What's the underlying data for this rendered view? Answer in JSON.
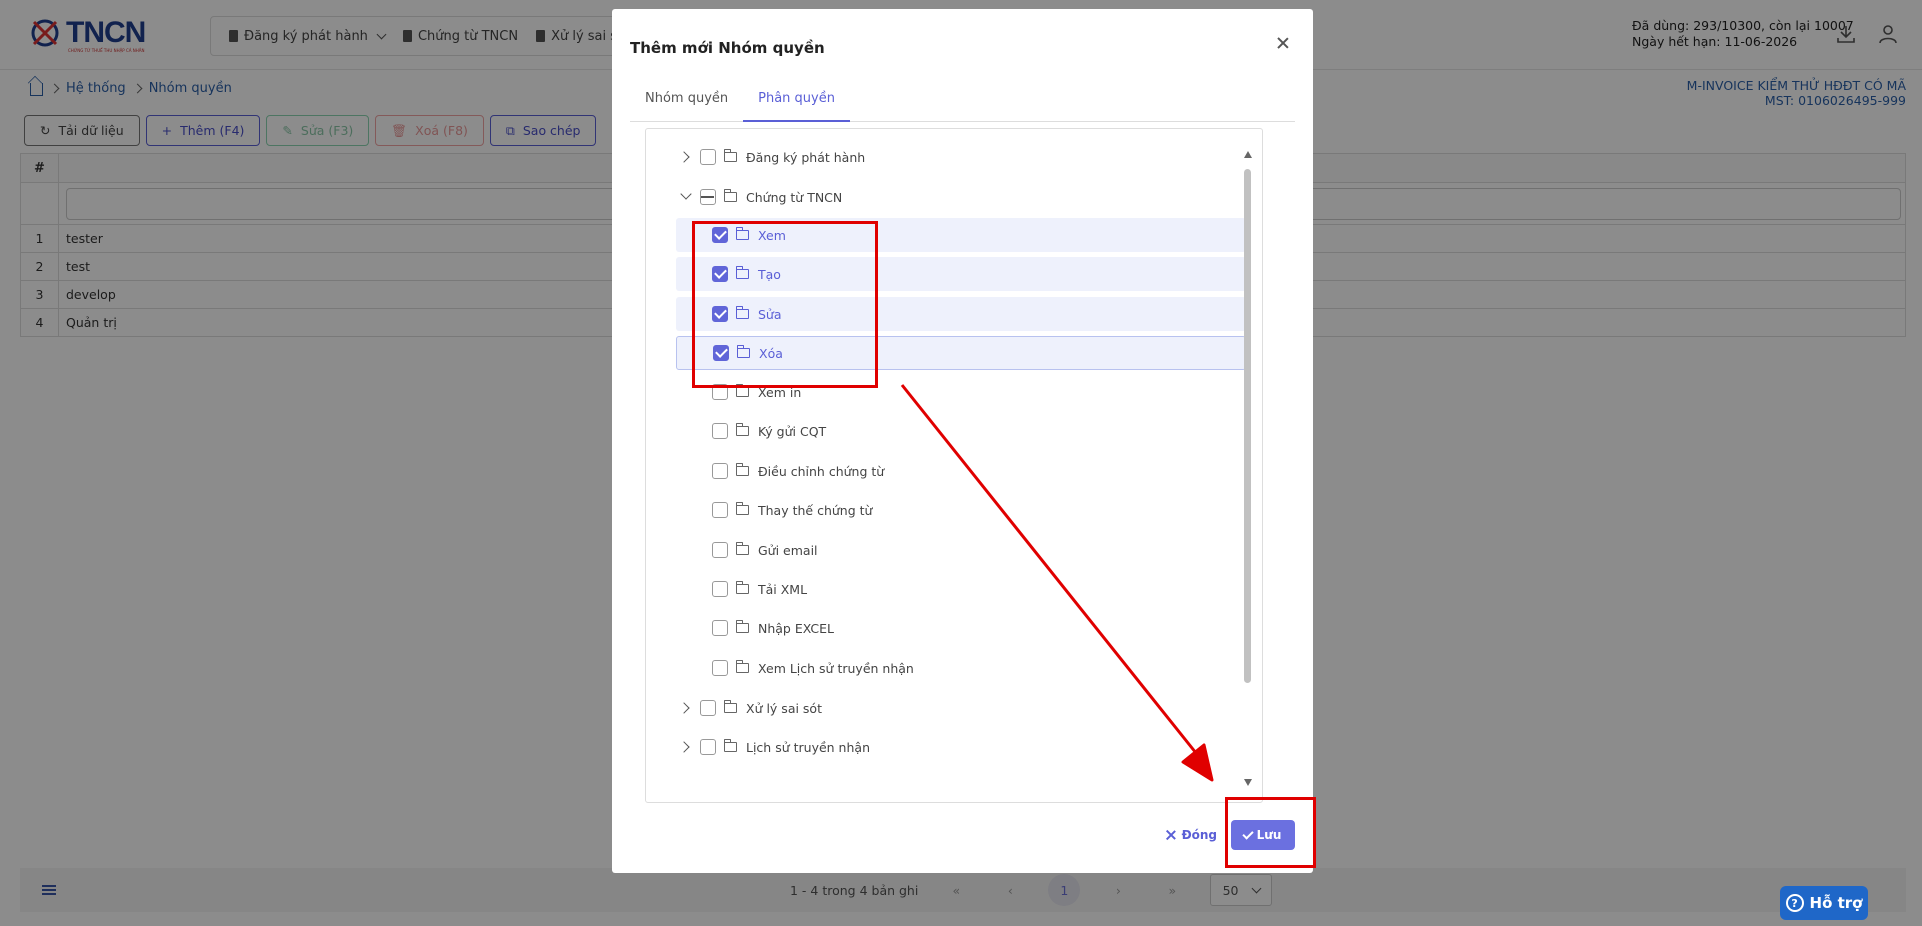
{
  "header": {
    "logo_text": "TNCN",
    "logo_sub": "CHỨNG TỪ THUẾ THU NHẬP CÁ NHÂN",
    "nav": [
      {
        "label": "Đăng ký phát hành"
      },
      {
        "label": "Chứng từ TNCN"
      },
      {
        "label": "Xử lý sai sót"
      }
    ],
    "usage_line1": "Đã dùng: 293/10300, còn lại 10007",
    "usage_line2": "Ngày hết hạn: 11-06-2026"
  },
  "breadcrumb": {
    "items": [
      "Hệ thống",
      "Nhóm quyền"
    ]
  },
  "company": {
    "name": "M-INVOICE KIỂM THỬ HĐĐT CÓ MÃ",
    "mst": "MST: 0106026495-999"
  },
  "toolbar": {
    "reload": "Tải dữ liệu",
    "add": "Thêm (F4)",
    "edit": "Sửa (F3)",
    "delete": "Xoá (F8)",
    "copy": "Sao chép"
  },
  "grid": {
    "header_num": "#",
    "rows": [
      {
        "num": "1",
        "name": "tester"
      },
      {
        "num": "2",
        "name": "test"
      },
      {
        "num": "3",
        "name": "develop"
      },
      {
        "num": "4",
        "name": "Quản trị"
      }
    ]
  },
  "pager": {
    "summary": "1 - 4 trong 4 bản ghi",
    "first": "«",
    "prev": "‹",
    "current": "1",
    "next": "›",
    "last": "»",
    "page_size": "50"
  },
  "help": {
    "label": "Hỗ trợ",
    "glyph": "?"
  },
  "modal": {
    "title": "Thêm mới Nhóm quyền",
    "tabs": [
      {
        "label": "Nhóm quyền"
      },
      {
        "label": "Phân quyền"
      }
    ],
    "tree": {
      "root1": "Đăng ký phát hành",
      "root2": "Chứng từ TNCN",
      "children": [
        {
          "label": "Xem",
          "checked": true
        },
        {
          "label": "Tạo",
          "checked": true
        },
        {
          "label": "Sửa",
          "checked": true
        },
        {
          "label": "Xóa",
          "checked": true
        },
        {
          "label": "Xem in",
          "checked": false
        },
        {
          "label": "Ký gửi CQT",
          "checked": false
        },
        {
          "label": "Điều chỉnh chứng từ",
          "checked": false
        },
        {
          "label": "Thay thế chứng từ",
          "checked": false
        },
        {
          "label": "Gửi email",
          "checked": false
        },
        {
          "label": "Tải XML",
          "checked": false
        },
        {
          "label": "Nhập EXCEL",
          "checked": false
        },
        {
          "label": "Xem Lịch sử truyền nhận",
          "checked": false
        }
      ],
      "root3": "Xử lý sai sót",
      "root4": "Lịch sử truyền nhận"
    },
    "close_label": "Đóng",
    "save_label": "Lưu"
  },
  "colors": {
    "accent": "#5a5fd6",
    "annotation": "#e00000",
    "help": "#1f67c8"
  }
}
